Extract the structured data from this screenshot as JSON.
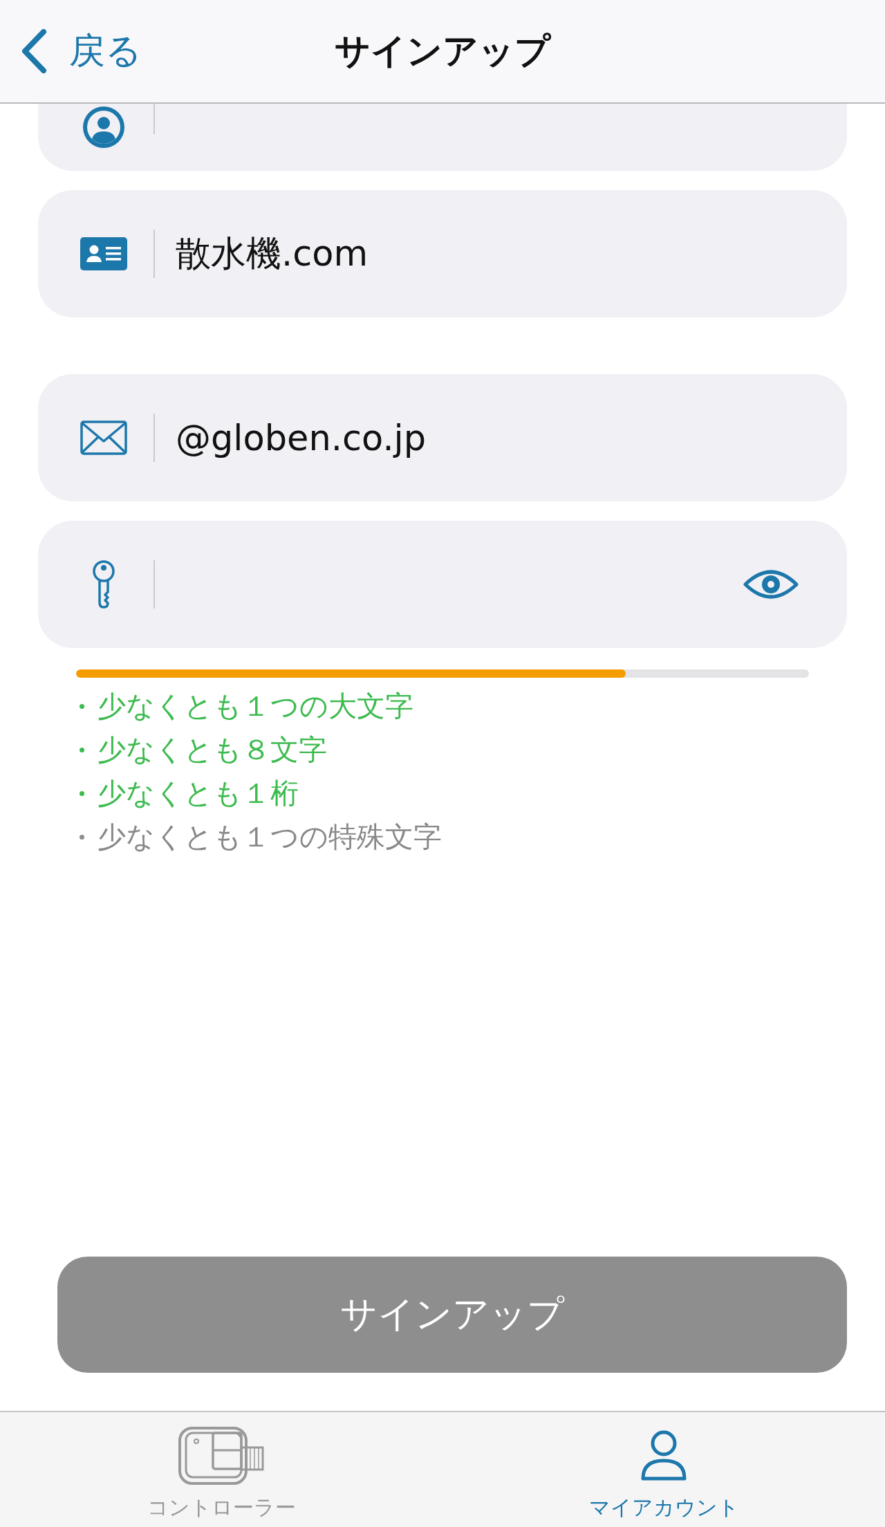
{
  "header": {
    "back_label": "戻る",
    "title": "サインアップ"
  },
  "field_groups": [
    [
      {
        "kind": "person",
        "cut_off": true
      },
      {
        "kind": "id-card",
        "value": "散水機.com"
      }
    ],
    [
      {
        "kind": "mail",
        "value": "@globen.co.jp"
      },
      {
        "kind": "key",
        "visibility_toggle": true
      }
    ]
  ],
  "strength": {
    "level": 0.75
  },
  "rules": [
    {
      "text": "少なくとも１つの大文字",
      "met": true
    },
    {
      "text": "少なくとも８文字",
      "met": true
    },
    {
      "text": "少なくとも１桁",
      "met": true
    },
    {
      "text": "少なくとも１つの特殊文字",
      "met": false
    }
  ],
  "submit": {
    "label": "サインアップ",
    "disabled": true
  },
  "tabs": [
    {
      "kind": "controller",
      "label": "コントローラー",
      "selected": false
    },
    {
      "kind": "account",
      "label": "マイアカウント",
      "selected": true
    }
  ]
}
